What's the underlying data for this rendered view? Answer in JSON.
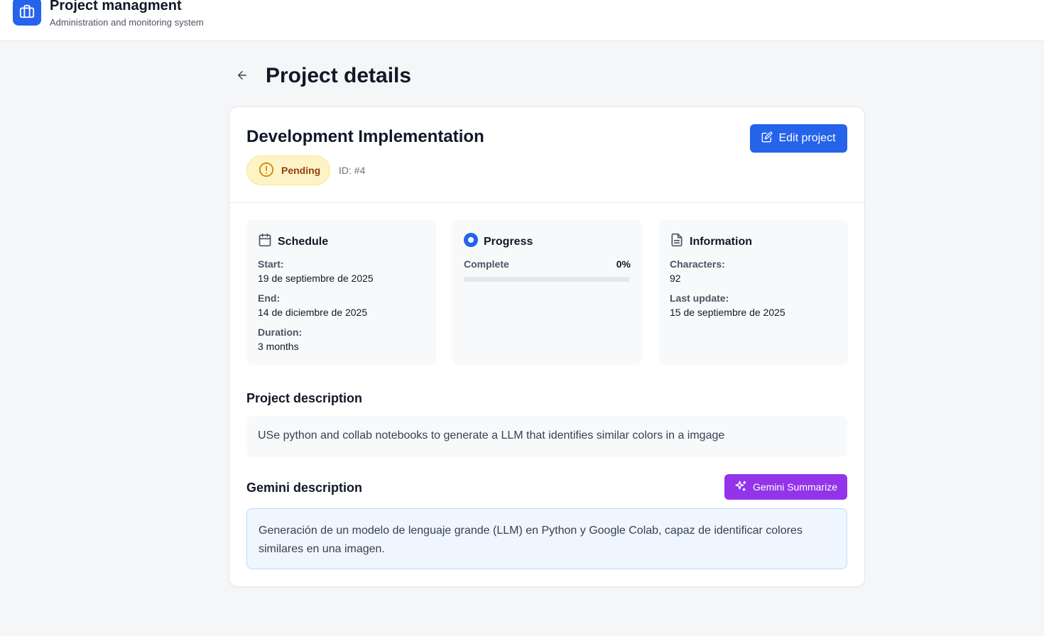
{
  "header": {
    "app_title": "Project managment",
    "app_subtitle": "Administration and monitoring system",
    "logo_icon": "briefcase-icon"
  },
  "page": {
    "title": "Project details",
    "back_icon": "arrow-left-icon"
  },
  "project": {
    "name": "Development Implementation",
    "status": "Pending",
    "status_icon": "alert-circle-icon",
    "id_label": "ID: #4",
    "edit_label": "Edit project"
  },
  "schedule": {
    "heading": "Schedule",
    "start_label": "Start:",
    "start_value": "19 de septiembre de 2025",
    "end_label": "End:",
    "end_value": "14 de diciembre de 2025",
    "duration_label": "Duration:",
    "duration_value": "3 months"
  },
  "progress": {
    "heading": "Progress",
    "complete_label": "Complete",
    "percent_text": "0%",
    "percent": 0
  },
  "information": {
    "heading": "Information",
    "characters_label": "Characters:",
    "characters_value": "92",
    "last_update_label": "Last update:",
    "last_update_value": "15 de septiembre de 2025"
  },
  "description": {
    "heading": "Project description",
    "text": "USe python and collab notebooks to generate a LLM that identifies similar colors in a imgage"
  },
  "gemini": {
    "heading": "Gemini description",
    "button_label": "Gemini Summarize",
    "text": "Generación de un modelo de lenguaje grande (LLM) en Python y Google Colab, capaz de identificar colores similares en una imagen."
  },
  "colors": {
    "primary": "#2563eb",
    "gemini": "#9333ea",
    "pending_bg": "#fef3c7",
    "pending_text": "#92400e"
  }
}
